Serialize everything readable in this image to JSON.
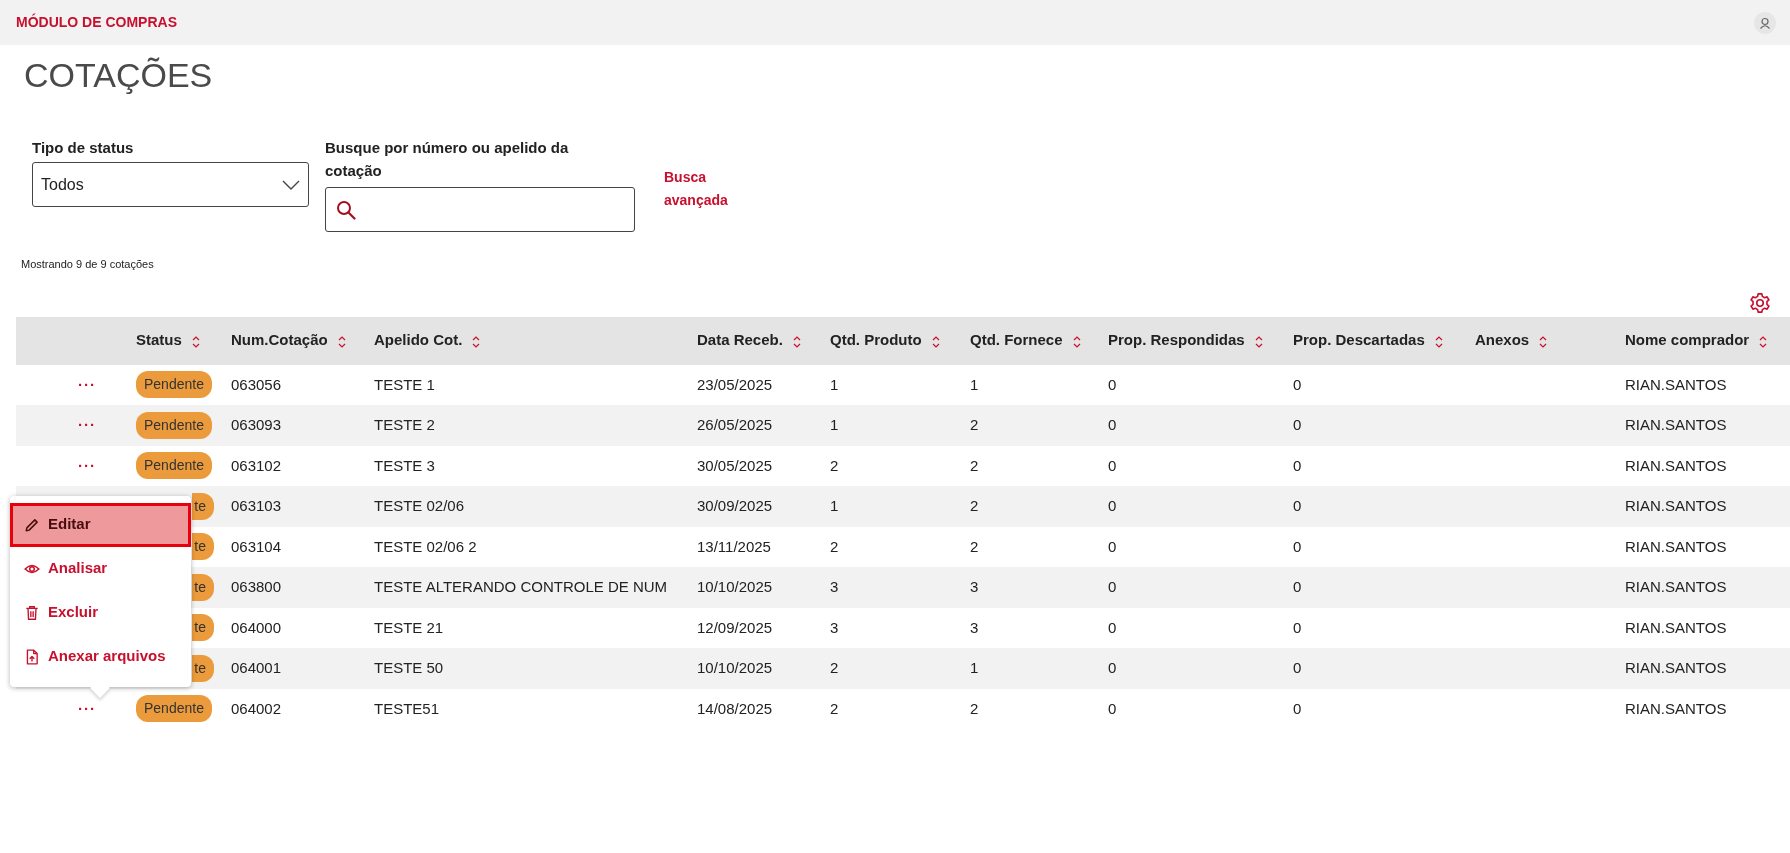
{
  "header": {
    "title": "MÓDULO DE COMPRAS"
  },
  "page_title": "COTAÇÕES",
  "filters": {
    "status": {
      "label": "Tipo de status",
      "value": "Todos"
    },
    "search": {
      "label": "Busque por número ou apelido da cotação"
    },
    "advanced_link": "Busca avançada"
  },
  "summary": "Mostrando 9 de 9 cotações",
  "table": {
    "columns": [
      "Status",
      "Num.Cotação",
      "Apelido Cot.",
      "Data Receb.",
      "Qtd. Produto",
      "Qtd. Fornece",
      "Prop. Respondidas",
      "Prop. Descartadas",
      "Anexos",
      "Nome comprador"
    ],
    "rows": [
      {
        "actions": "···",
        "under_menu": false,
        "status": "Pendente",
        "num": "063056",
        "apelido": "TESTE 1",
        "data": "23/05/2025",
        "qtd_produto": "1",
        "qtd_fornece": "1",
        "prop_respondidas": "0",
        "prop_descartadas": "0",
        "comprador": "RIAN.SANTOS"
      },
      {
        "actions": "···",
        "under_menu": false,
        "status": "Pendente",
        "num": "063093",
        "apelido": "TESTE 2",
        "data": "26/05/2025",
        "qtd_produto": "1",
        "qtd_fornece": "2",
        "prop_respondidas": "0",
        "prop_descartadas": "0",
        "comprador": "RIAN.SANTOS"
      },
      {
        "actions": "···",
        "under_menu": false,
        "status": "Pendente",
        "num": "063102",
        "apelido": "TESTE 3",
        "data": "30/05/2025",
        "qtd_produto": "2",
        "qtd_fornece": "2",
        "prop_respondidas": "0",
        "prop_descartadas": "0",
        "comprador": "RIAN.SANTOS"
      },
      {
        "under_menu": true,
        "status": "te",
        "num": "063103",
        "apelido": "TESTE 02/06",
        "data": "30/09/2025",
        "qtd_produto": "1",
        "qtd_fornece": "2",
        "prop_respondidas": "0",
        "prop_descartadas": "0",
        "comprador": "RIAN.SANTOS"
      },
      {
        "under_menu": true,
        "status": "te",
        "num": "063104",
        "apelido": "TESTE 02/06 2",
        "data": "13/11/2025",
        "qtd_produto": "2",
        "qtd_fornece": "2",
        "prop_respondidas": "0",
        "prop_descartadas": "0",
        "comprador": "RIAN.SANTOS"
      },
      {
        "under_menu": true,
        "status": "te",
        "num": "063800",
        "apelido": "TESTE ALTERANDO CONTROLE DE NUM",
        "data": "10/10/2025",
        "qtd_produto": "3",
        "qtd_fornece": "3",
        "prop_respondidas": "0",
        "prop_descartadas": "0",
        "comprador": "RIAN.SANTOS"
      },
      {
        "under_menu": true,
        "status": "te",
        "num": "064000",
        "apelido": "TESTE 21",
        "data": "12/09/2025",
        "qtd_produto": "3",
        "qtd_fornece": "3",
        "prop_respondidas": "0",
        "prop_descartadas": "0",
        "comprador": "RIAN.SANTOS"
      },
      {
        "under_menu": true,
        "status": "te",
        "num": "064001",
        "apelido": "TESTE 50",
        "data": "10/10/2025",
        "qtd_produto": "2",
        "qtd_fornece": "1",
        "prop_respondidas": "0",
        "prop_descartadas": "0",
        "comprador": "RIAN.SANTOS"
      },
      {
        "actions": "···",
        "under_menu": false,
        "status": "Pendente",
        "num": "064002",
        "apelido": "TESTE51",
        "data": "14/08/2025",
        "qtd_produto": "2",
        "qtd_fornece": "2",
        "prop_respondidas": "0",
        "prop_descartadas": "0",
        "comprador": "RIAN.SANTOS"
      }
    ]
  },
  "row_menu": {
    "items": [
      {
        "kind": "edit",
        "label": "Editar",
        "selected": true
      },
      {
        "kind": "view",
        "label": "Analisar",
        "selected": false
      },
      {
        "kind": "delete",
        "label": "Excluir",
        "selected": false
      },
      {
        "kind": "attach",
        "label": "Anexar arquivos",
        "selected": false
      }
    ]
  }
}
